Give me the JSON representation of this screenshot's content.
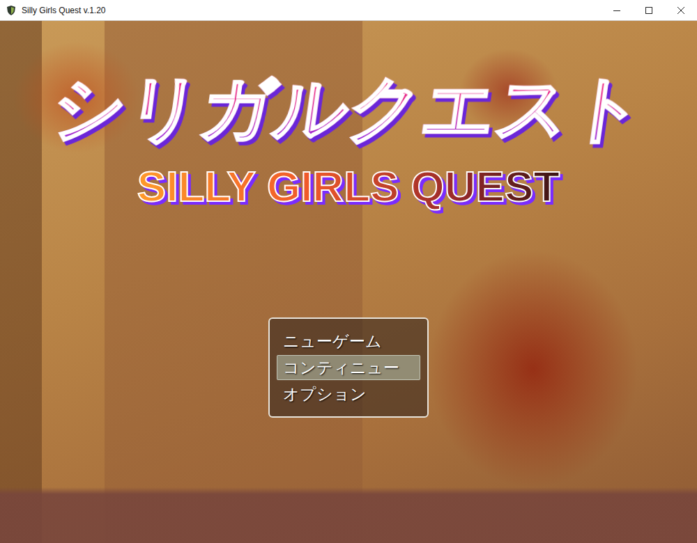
{
  "window": {
    "title": "Silly Girls Quest v.1.20"
  },
  "logo": {
    "japanese": "シリガルクエスト",
    "english": "SILLY GIRLS QUEST"
  },
  "menu": [
    {
      "label": "ニューゲーム",
      "selected": false
    },
    {
      "label": "コンティニュー",
      "selected": true
    },
    {
      "label": "オプション",
      "selected": false
    }
  ]
}
